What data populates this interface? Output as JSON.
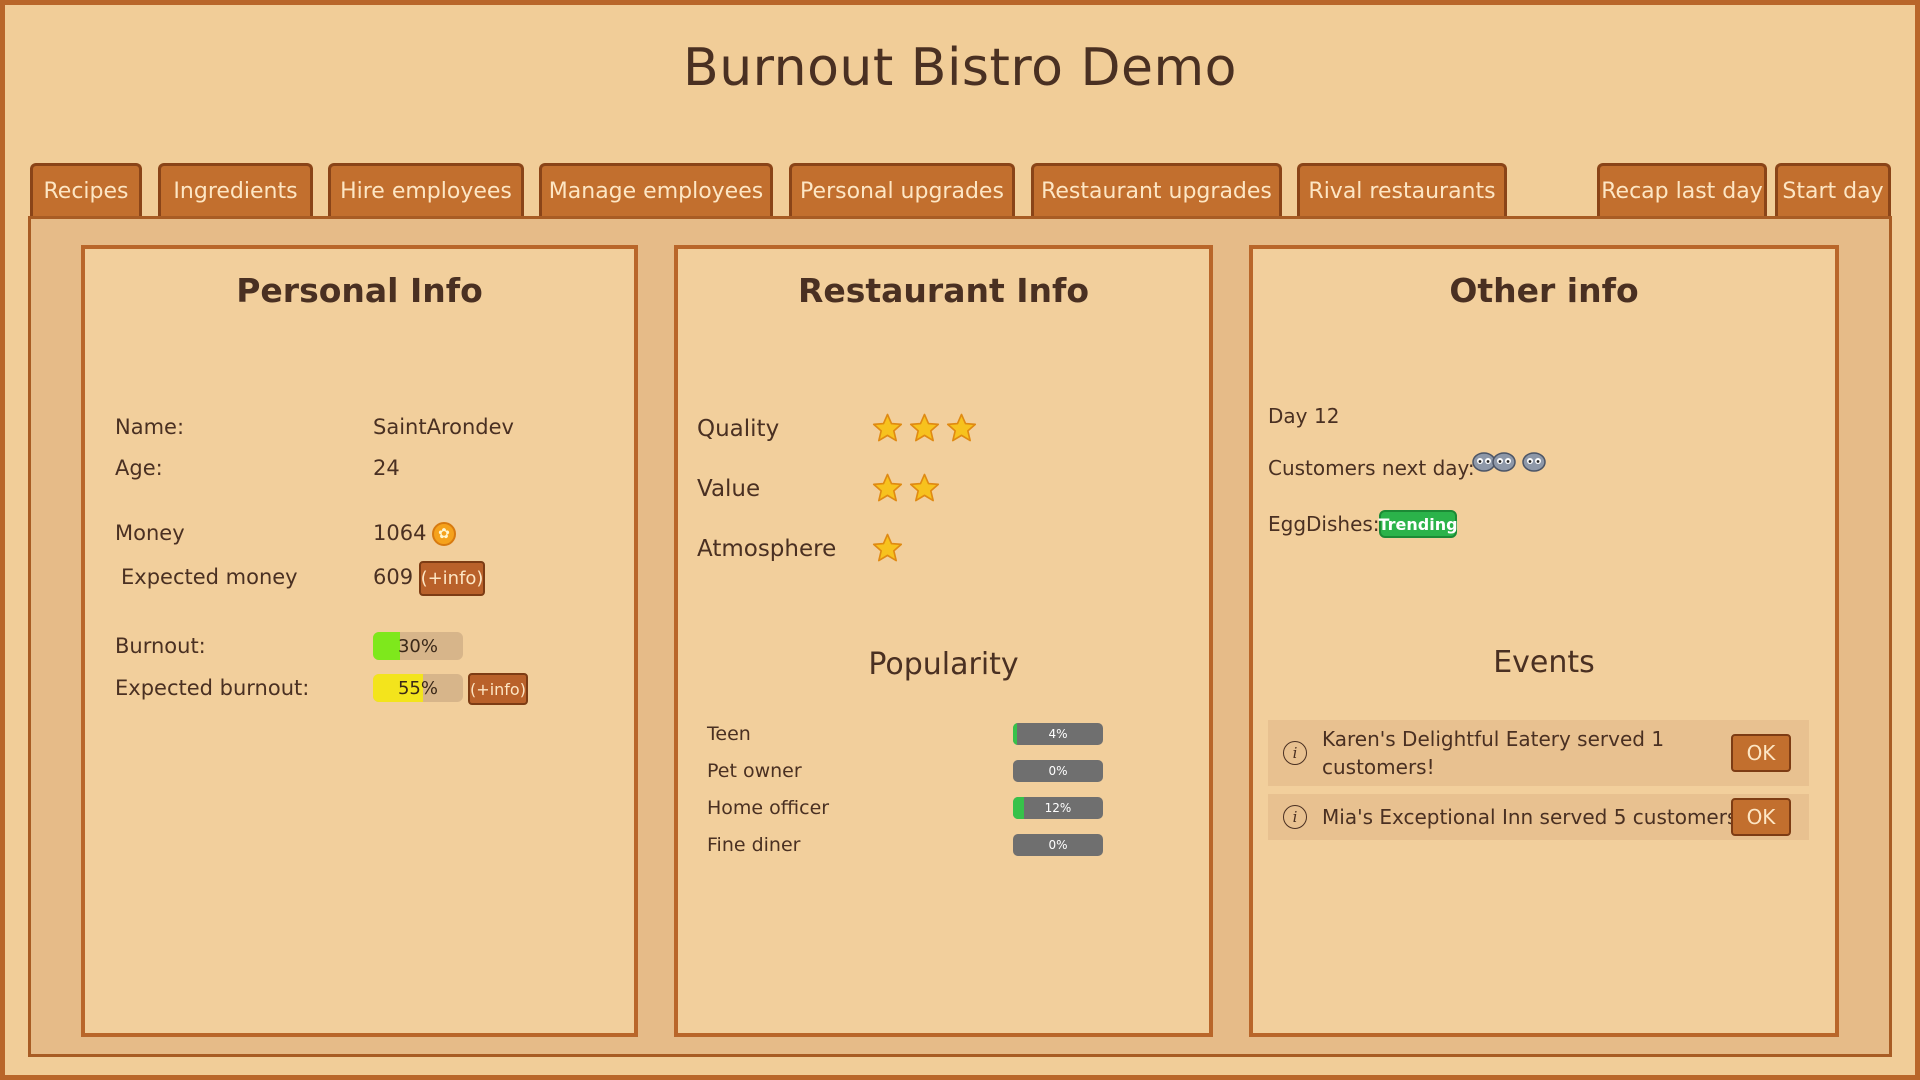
{
  "title": "Burnout Bistro Demo",
  "tabs": [
    {
      "label": "Recipes"
    },
    {
      "label": "Ingredients"
    },
    {
      "label": "Hire employees"
    },
    {
      "label": "Manage employees"
    },
    {
      "label": "Personal upgrades"
    },
    {
      "label": "Restaurant upgrades"
    },
    {
      "label": "Rival restaurants"
    }
  ],
  "actions": {
    "recap_label": "Recap last day",
    "start_label": "Start day"
  },
  "personal": {
    "title": "Personal Info",
    "name_label": "Name:",
    "name_value": "SaintArondev",
    "age_label": "Age:",
    "age_value": "24",
    "money_label": "Money",
    "money_value": "1064",
    "expected_money_label": "Expected money",
    "expected_money_value": "609",
    "info_label": "(+info)",
    "burnout_label": "Burnout:",
    "burnout_text": "30%",
    "burnout_fraction": 0.3,
    "expected_burnout_label": "Expected burnout:",
    "expected_burnout_text": "55%",
    "expected_burnout_fraction": 0.55,
    "colors": {
      "burnout": "#7ee81c",
      "expected_burnout": "#f3e41c"
    }
  },
  "restaurant": {
    "title": "Restaurant Info",
    "ratings": [
      {
        "label": "Quality",
        "stars": 3
      },
      {
        "label": "Value",
        "stars": 2
      },
      {
        "label": "Atmosphere",
        "stars": 1
      }
    ],
    "popularity_title": "Popularity",
    "popularity": [
      {
        "label": "Teen",
        "text": "4%",
        "fraction": 0.04
      },
      {
        "label": "Pet owner",
        "text": "0%",
        "fraction": 0
      },
      {
        "label": "Home officer",
        "text": "12%",
        "fraction": 0.12
      },
      {
        "label": "Fine diner",
        "text": "0%",
        "fraction": 0
      }
    ]
  },
  "other": {
    "title": "Other info",
    "day_label": "Day",
    "day_value": "12",
    "customers_label": "Customers next day:",
    "customer_icon_count": 3,
    "trend_label": "EggDishes:",
    "trend_badge": "Trending",
    "events_title": "Events",
    "events": [
      {
        "text_line1": "Karen's Delightful Eatery served 1",
        "text_line2": "customers!",
        "ok": "OK"
      },
      {
        "text_line1": "Mia's Exceptional Inn served 5 customers!",
        "text_line2": "",
        "ok": "OK"
      }
    ]
  }
}
